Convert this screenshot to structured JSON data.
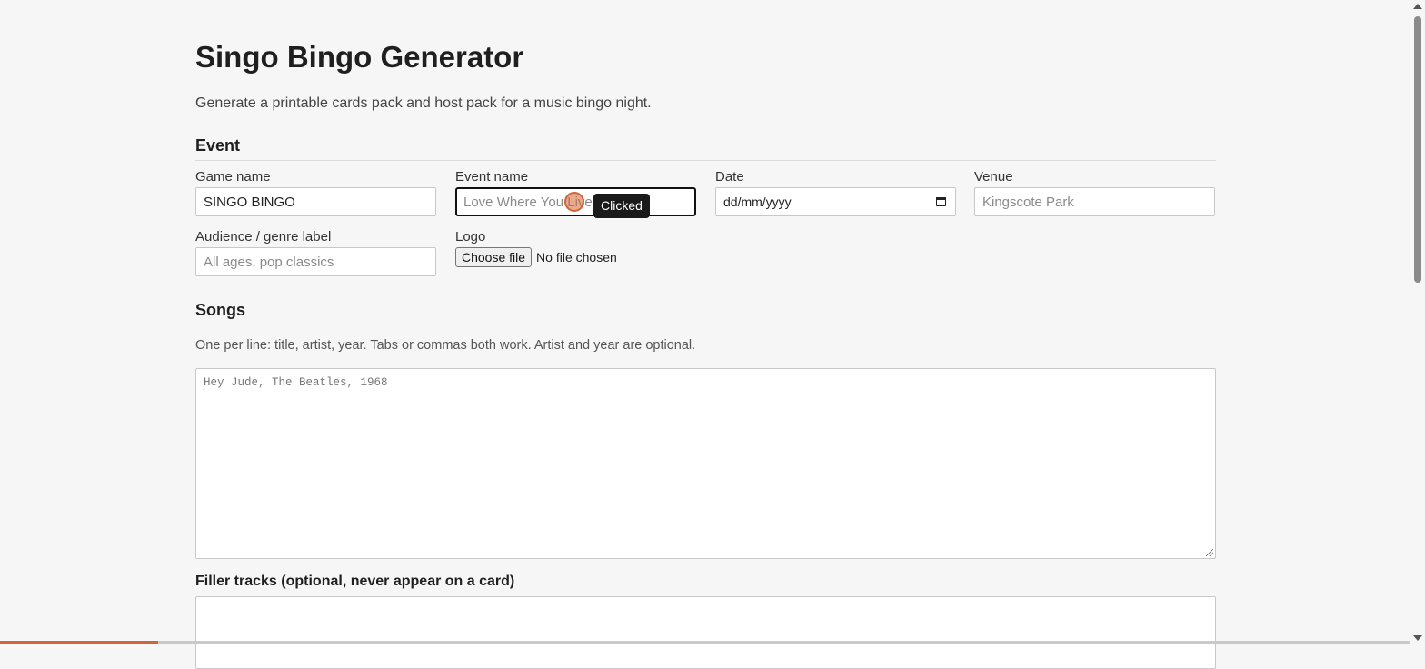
{
  "page": {
    "title": "Singo Bingo Generator",
    "subtitle": "Generate a printable cards pack and host pack for a music bingo night."
  },
  "event_section": {
    "title": "Event",
    "game_name": {
      "label": "Game name",
      "value": "SINGO BINGO"
    },
    "event_name": {
      "label": "Event name",
      "value": "",
      "placeholder": "Love Where You Live"
    },
    "date": {
      "label": "Date",
      "value": "dd/mm/yyyy",
      "icon": "calendar-icon"
    },
    "venue": {
      "label": "Venue",
      "value": "",
      "placeholder": "Kingscote Park"
    },
    "audience": {
      "label": "Audience / genre label",
      "value": "",
      "placeholder": "All ages, pop classics"
    },
    "logo": {
      "label": "Logo",
      "button_label": "Choose file",
      "status": "No file chosen"
    }
  },
  "songs_section": {
    "title": "Songs",
    "hint": "One per line: title, artist, year. Tabs or commas both work. Artist and year are optional.",
    "placeholder": "Hey Jude, The Beatles, 1968",
    "value": ""
  },
  "filler_section": {
    "label": "Filler tracks (optional, never appear on a card)",
    "value": ""
  },
  "overlay": {
    "tooltip": "Clicked",
    "accent_color": "#d2643a"
  },
  "progress": {
    "fraction": 0.112
  }
}
